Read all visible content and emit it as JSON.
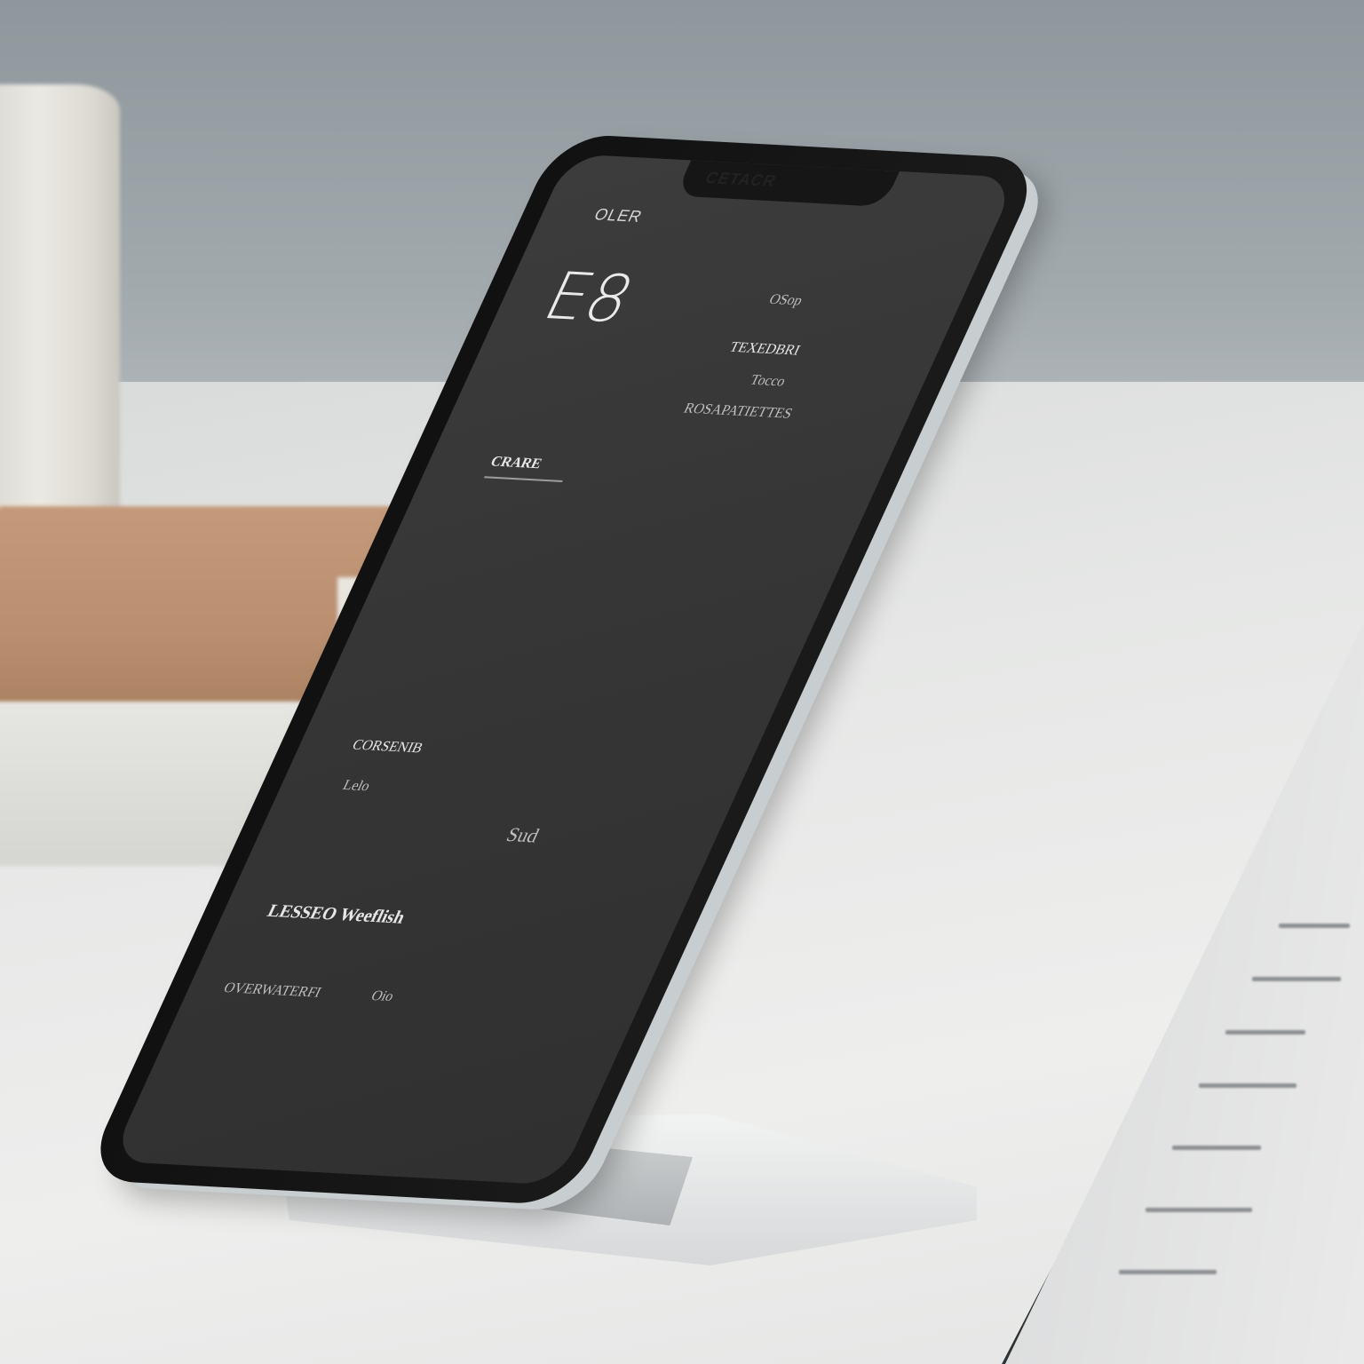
{
  "phone_screen": {
    "notch_text": "CETACR",
    "status_label": "OLER",
    "big_number": "E8",
    "right_block": {
      "line1": "OSop",
      "line2": "TEXEDBRI",
      "line3": "Tocco",
      "line4": "ROSAPATIETTES"
    },
    "section1_title": "CRARE",
    "section2_title": "CORSENIB",
    "section2_sub": "Lelo",
    "value_right": "Sud",
    "footer_main": "LESSEO Weeflish",
    "footer_sub": "OVERWATERFI",
    "footer_tail": "Oio"
  }
}
